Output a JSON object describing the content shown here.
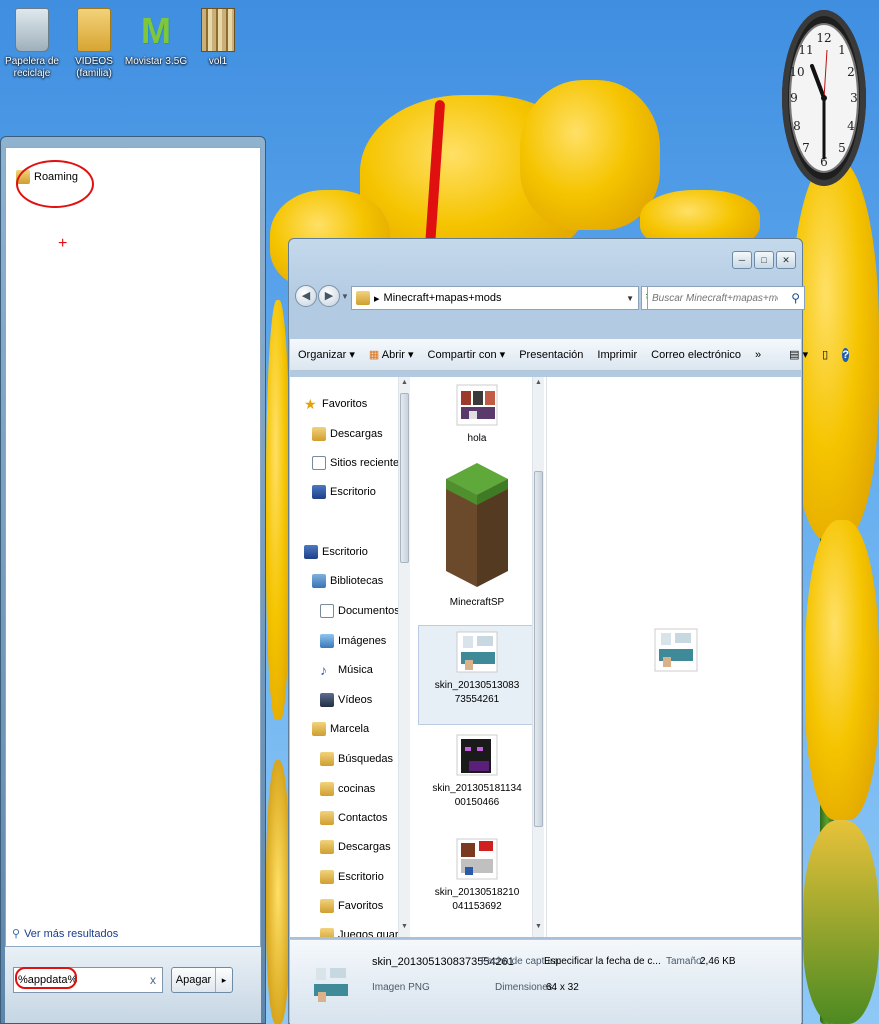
{
  "desktop": {
    "icons": [
      {
        "label": "Papelera de reciclaje",
        "icon": "recycle-bin-icon"
      },
      {
        "label": "VIDEOS (familia)",
        "icon": "folder-icon"
      },
      {
        "label": "Movistar 3.5G",
        "icon": "movistar-icon"
      },
      {
        "label": "vol1",
        "icon": "archive-icon"
      }
    ]
  },
  "start_menu": {
    "result": "Roaming",
    "see_more": "Ver más resultados",
    "search_value": "%appdata%",
    "clear_glyph": "x",
    "shutdown_label": "Apagar",
    "shutdown_arrow": "▸"
  },
  "explorer": {
    "address": {
      "crumb_arrow": "▸",
      "path": "Minecraft+mapas+mods"
    },
    "search_placeholder": "Buscar Minecraft+mapas+mods",
    "toolbar": {
      "organize": "Organizar ▾",
      "open": "Abrir ▾",
      "share": "Compartir con ▾",
      "slideshow": "Presentación",
      "print": "Imprimir",
      "email": "Correo electrónico",
      "more": "»"
    },
    "nav": [
      {
        "label": "Favoritos",
        "icon": "star"
      },
      {
        "label": "Descargas",
        "icon": "folder"
      },
      {
        "label": "Sitios recientes",
        "icon": "doc"
      },
      {
        "label": "Escritorio",
        "icon": "desk"
      },
      {
        "label": "Escritorio",
        "icon": "desk"
      },
      {
        "label": "Bibliotecas",
        "icon": "lib"
      },
      {
        "label": "Documentos",
        "icon": "doc"
      },
      {
        "label": "Imágenes",
        "icon": "img"
      },
      {
        "label": "Música",
        "icon": "music"
      },
      {
        "label": "Vídeos",
        "icon": "video"
      },
      {
        "label": "Marcela",
        "icon": "user"
      },
      {
        "label": "Búsquedas",
        "icon": "folder"
      },
      {
        "label": "cocinas",
        "icon": "folder"
      },
      {
        "label": "Contactos",
        "icon": "folder"
      },
      {
        "label": "Descargas",
        "icon": "folder"
      },
      {
        "label": "Escritorio",
        "icon": "folder"
      },
      {
        "label": "Favoritos",
        "icon": "folder"
      },
      {
        "label": "Juegos guardados",
        "icon": "folder"
      }
    ],
    "files": [
      {
        "name": "hola"
      },
      {
        "name": "MinecraftSP"
      },
      {
        "name": "skin_2013051308373554261"
      },
      {
        "name": "skin_20130518113400150466"
      },
      {
        "name": "skin_20130518210041153692"
      }
    ],
    "details": {
      "file_name": "skin_2013051308373554261",
      "file_type": "Imagen PNG",
      "date_label": "Fecha de captura:",
      "date_value": "Especificar la fecha de c...",
      "size_label": "Tamaño:",
      "size_value": "2,46 KB",
      "dim_label": "Dimensiones:",
      "dim_value": "64 x 32"
    }
  }
}
